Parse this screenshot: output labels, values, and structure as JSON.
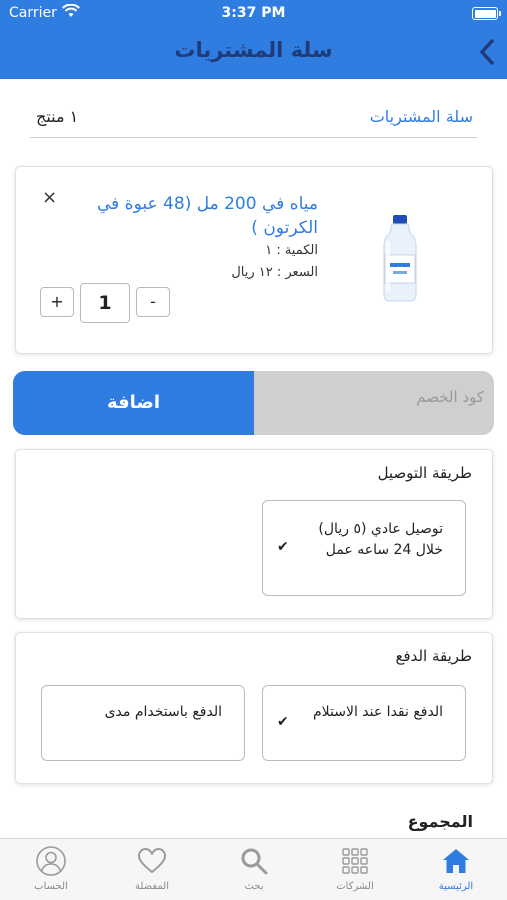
{
  "status_bar": {
    "carrier": "Carrier",
    "time": "3:37 PM"
  },
  "header": {
    "title": "سلة المشتريات"
  },
  "summary": {
    "cart_label": "سلة المشتريات",
    "count": "١ منتج"
  },
  "product": {
    "name": "مياه في 200 مل (48 عبوة في الكرتون )",
    "quantity": "الكمية : ١",
    "price": "السعر : ١٢ ريال",
    "stepper_value": "1",
    "plus": "+",
    "minus": "-",
    "close": "×"
  },
  "coupon": {
    "placeholder": "كود الخصم",
    "add_label": "اضافة"
  },
  "delivery": {
    "title": "طريقة التوصيل",
    "options": [
      {
        "label": "توصيل عادي (٥ ريال) خلال 24 ساعه عمل",
        "selected": true
      }
    ]
  },
  "payment": {
    "title": "طريقة الدفع",
    "options": [
      {
        "label": "الدفع نقدا عند الاستلام",
        "selected": true
      },
      {
        "label": "الدفع باستخدام مدى",
        "selected": false
      }
    ]
  },
  "total_label": "المجموع",
  "tabs": [
    {
      "label": "الرئيسية",
      "icon": "home-icon",
      "active": true
    },
    {
      "label": "الشركات",
      "icon": "grid-icon",
      "active": false
    },
    {
      "label": "بحث",
      "icon": "search-icon",
      "active": false
    },
    {
      "label": "المفضلة",
      "icon": "heart-icon",
      "active": false
    },
    {
      "label": "الحساب",
      "icon": "user-icon",
      "active": false
    }
  ],
  "colors": {
    "primary": "#2f7de1",
    "header_title": "#1f3b7a",
    "coupon_bg": "#cfcfcf"
  }
}
